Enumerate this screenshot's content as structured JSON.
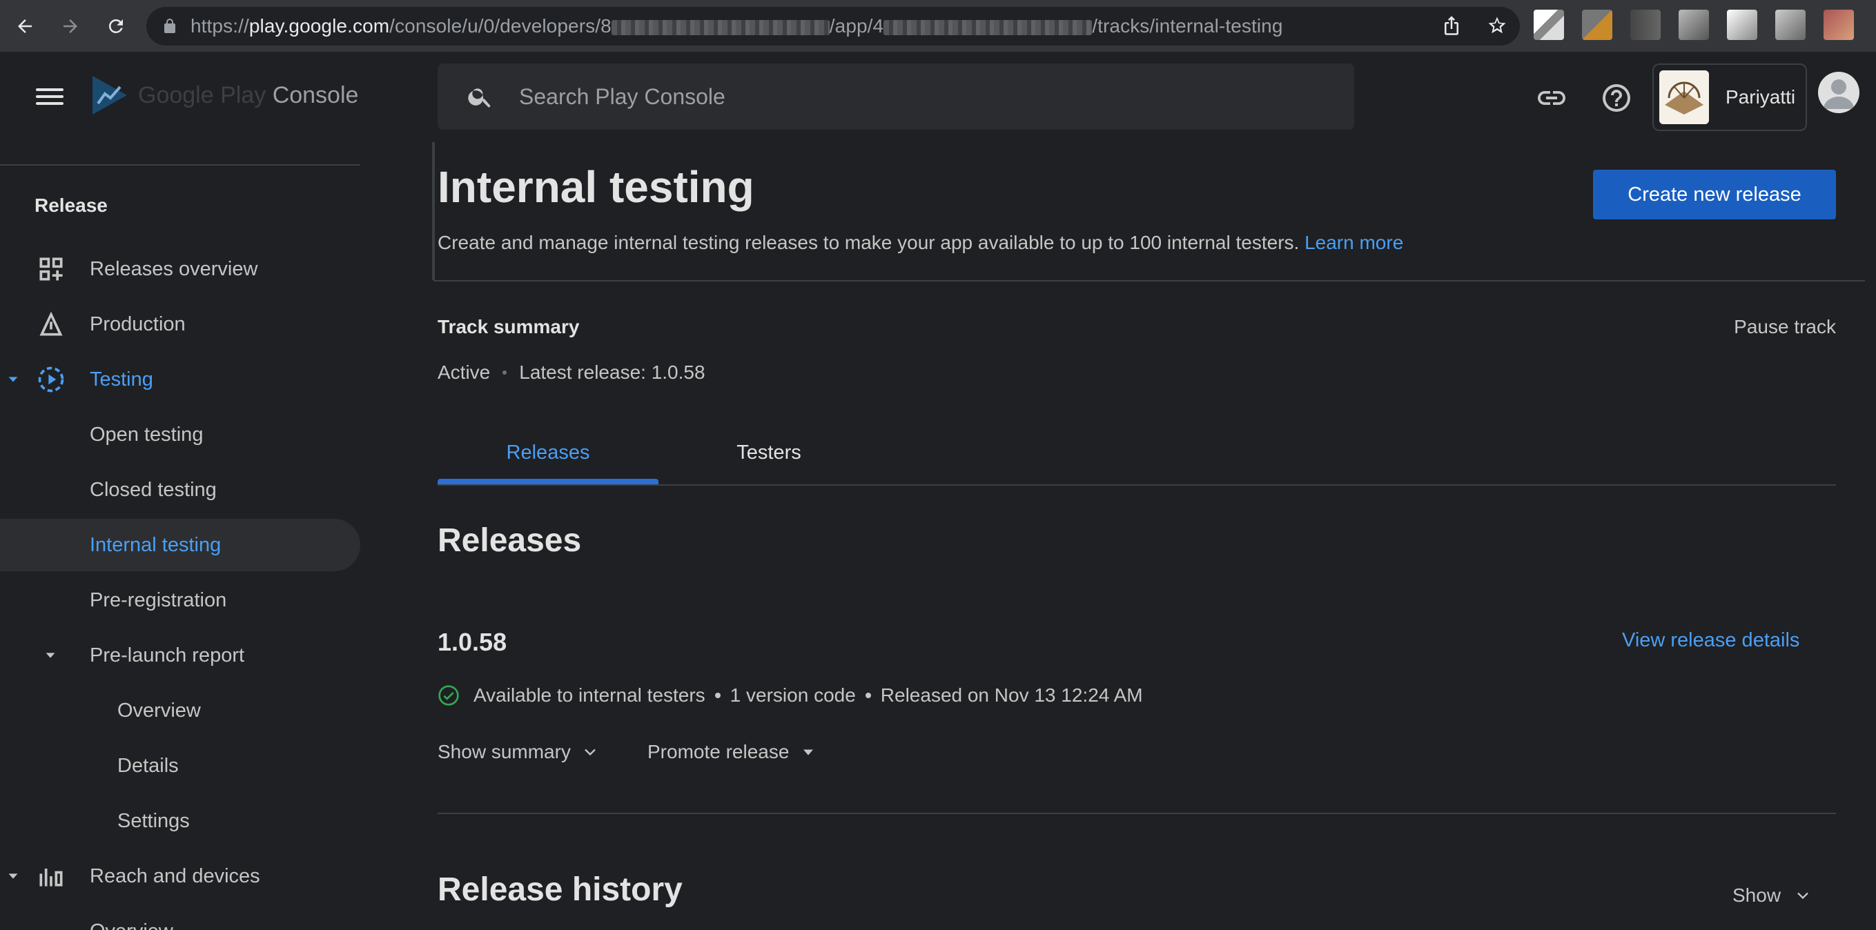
{
  "browser": {
    "url_prefix": "https://",
    "url_host": "play.google.com",
    "url_path_1": "/console/u/0/developers/8",
    "url_path_2": "/app/4",
    "url_path_3": "/tracks/internal-testing"
  },
  "header": {
    "brand_name": "Google Play",
    "brand_suffix": "Console",
    "search_placeholder": "Search Play Console",
    "account_name": "Pariyatti"
  },
  "sidebar": {
    "section_header": "Release",
    "items": [
      {
        "label": "Releases overview",
        "icon": "releases-overview-icon"
      },
      {
        "label": "Production",
        "icon": "production-icon"
      },
      {
        "label": "Testing",
        "icon": "testing-icon"
      },
      {
        "label": "Open testing"
      },
      {
        "label": "Closed testing"
      },
      {
        "label": "Internal testing"
      },
      {
        "label": "Pre-registration"
      },
      {
        "label": "Pre-launch report"
      },
      {
        "label": "Overview"
      },
      {
        "label": "Details"
      },
      {
        "label": "Settings"
      },
      {
        "label": "Reach and devices",
        "icon": "reach-devices-icon"
      },
      {
        "label": "Overview"
      }
    ]
  },
  "main": {
    "title": "Internal testing",
    "description": "Create and manage internal testing releases to make your app available to up to 100 internal testers.",
    "learn_more": "Learn more",
    "create_button": "Create new release",
    "track_summary_label": "Track summary",
    "pause_track": "Pause track",
    "track_status": "Active",
    "latest_release": "Latest release: 1.0.58",
    "tabs": [
      {
        "label": "Releases",
        "active": true
      },
      {
        "label": "Testers",
        "active": false
      }
    ],
    "releases_title": "Releases",
    "release": {
      "version": "1.0.58",
      "view_details": "View release details",
      "status": "Available to internal testers",
      "version_codes": "1 version code",
      "released_on": "Released on Nov 13 12:24 AM"
    },
    "show_summary": "Show summary",
    "promote_release": "Promote release",
    "release_history_title": "Release history",
    "show": "Show"
  },
  "colors": {
    "accent": "#4a9ff5",
    "primary_button": "#1a5fc0",
    "background": "#1f2023",
    "success": "#34a853"
  }
}
